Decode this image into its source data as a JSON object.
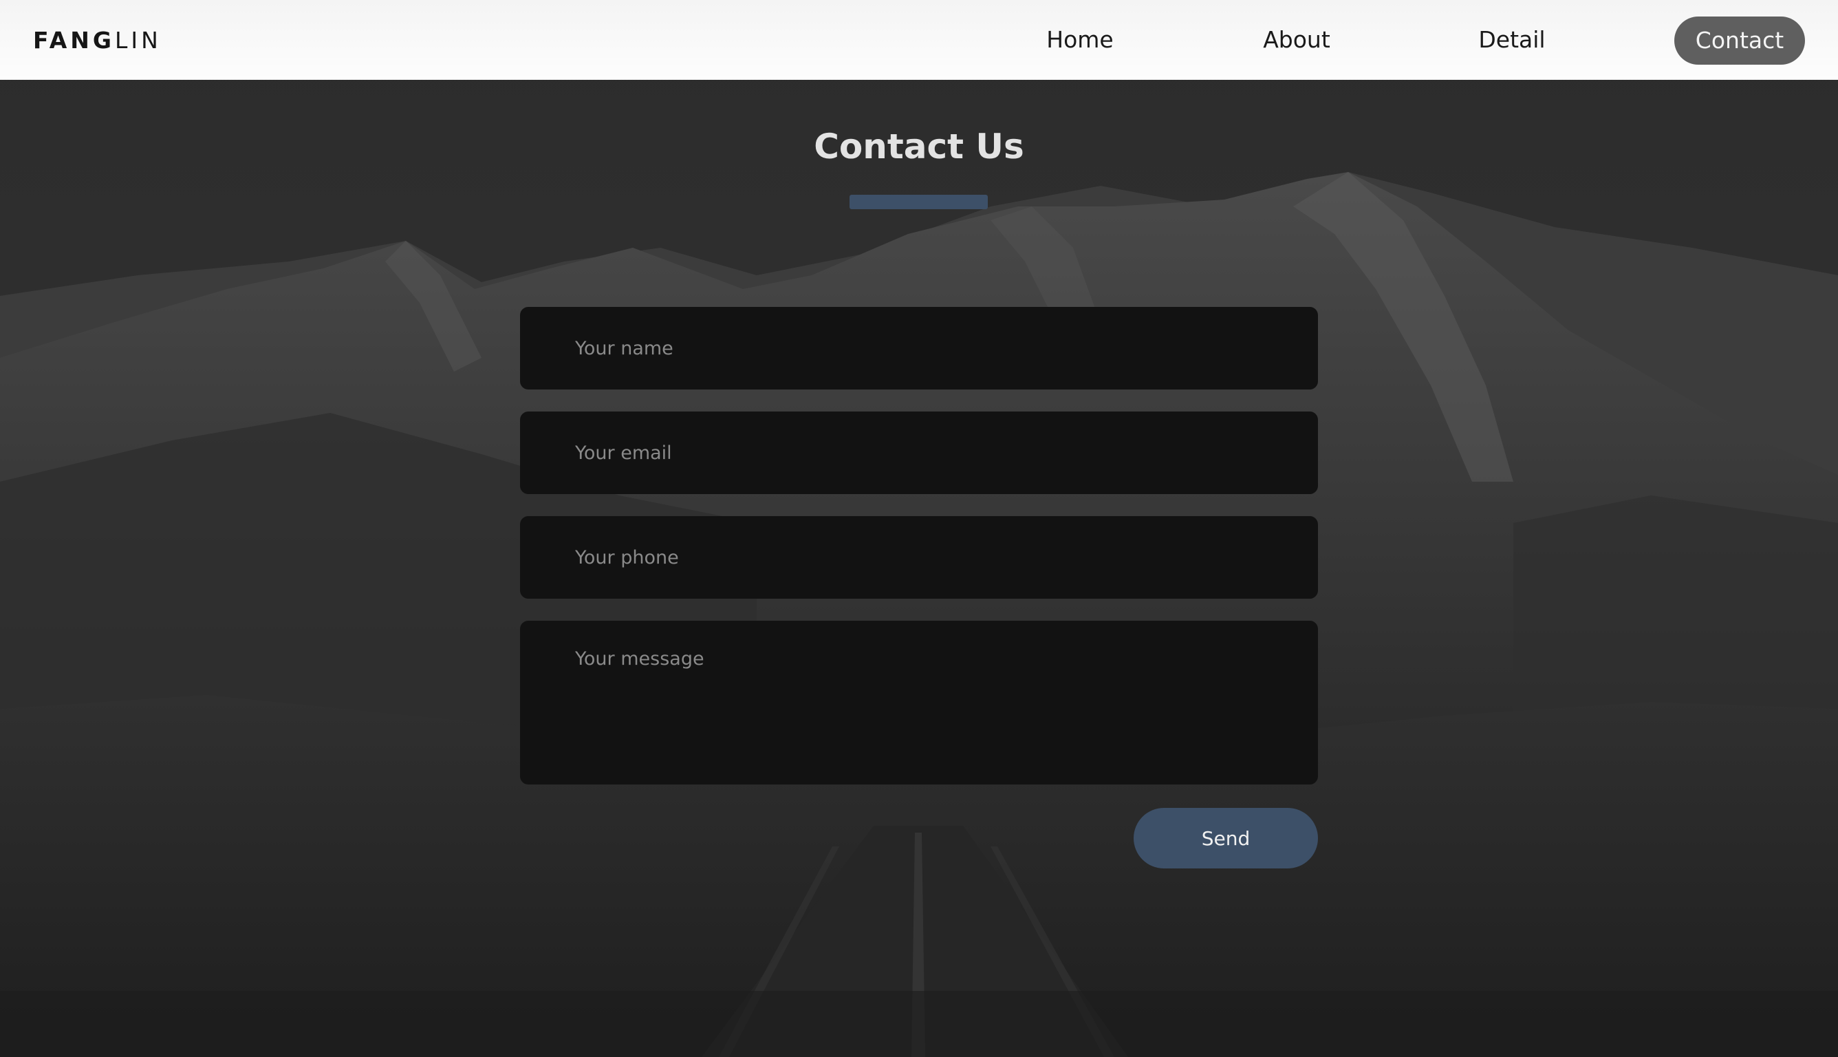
{
  "brand": {
    "logo_bold": "FANG",
    "logo_light": "LIN"
  },
  "nav": {
    "items": [
      {
        "label": "Home"
      },
      {
        "label": "About"
      },
      {
        "label": "Detail"
      },
      {
        "label": "Contact",
        "active": true
      }
    ]
  },
  "contact": {
    "title": "Contact Us",
    "fields": {
      "name_placeholder": "Your name",
      "email_placeholder": "Your email",
      "phone_placeholder": "Your phone",
      "message_placeholder": "Your message"
    },
    "send_label": "Send"
  },
  "colors": {
    "accent": "#3d5068",
    "active_nav": "#5f5f5f",
    "field_bg": "#121212"
  }
}
